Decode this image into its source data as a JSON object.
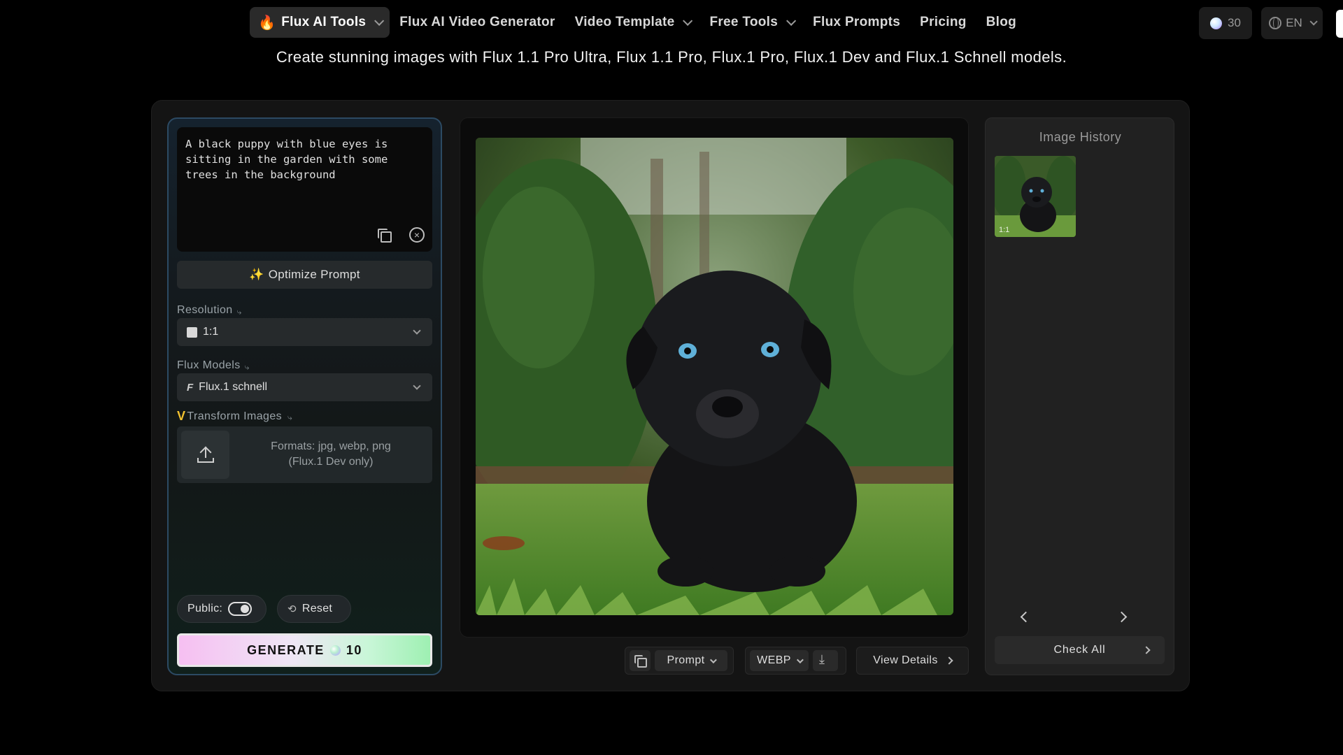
{
  "nav": {
    "items": [
      {
        "label": "Flux AI Tools",
        "dropdown": true,
        "active": true
      },
      {
        "label": "Flux AI Video Generator",
        "dropdown": false
      },
      {
        "label": "Video Template",
        "dropdown": true
      },
      {
        "label": "Free Tools",
        "dropdown": true
      },
      {
        "label": "Flux Prompts",
        "dropdown": false
      },
      {
        "label": "Pricing",
        "dropdown": false
      },
      {
        "label": "Blog",
        "dropdown": false
      }
    ],
    "credits": "30",
    "language": "EN"
  },
  "subtitle": "Create stunning images with Flux 1.1 Pro Ultra, Flux 1.1 Pro, Flux.1 Pro, Flux.1 Dev and Flux.1 Schnell models.",
  "left_panel": {
    "prompt": "A black puppy with blue eyes is sitting in the garden with some trees in the background",
    "optimize_label": "Optimize Prompt",
    "resolution_label": "Resolution",
    "resolution_value": "1:1",
    "models_label": "Flux Models",
    "model_value": "Flux.1 schnell",
    "transform_mark": "V",
    "transform_label": "Transform Images",
    "upload_formats": "Formats: jpg, webp, png",
    "upload_note": "(Flux.1 Dev only)",
    "public_label": "Public:",
    "public_on": true,
    "reset_label": "Reset",
    "generate_label": "GENERATE",
    "generate_cost": "10"
  },
  "center_panel": {
    "prompt_button": "Prompt",
    "format_button": "WEBP",
    "view_details": "View Details"
  },
  "right_panel": {
    "title": "Image History",
    "thumb_ratio": "1:1",
    "check_all": "Check All"
  },
  "colors": {
    "background": "#000000",
    "panel": "#141414",
    "accent_border": "#2c4a63",
    "generate_gradient_start": "#f6bff2",
    "generate_gradient_end": "#9ef0b2",
    "transform_mark": "#f2c230"
  },
  "icons": [
    "fire-icon",
    "chevron-down-icon",
    "credit-dot-icon",
    "globe-icon",
    "copy-icon",
    "clear-icon",
    "sparkle-icon",
    "square-ratio-icon",
    "flux-icon",
    "upload-icon",
    "toggle-icon",
    "reset-icon",
    "download-icon",
    "chevron-left-icon",
    "chevron-right-icon"
  ]
}
